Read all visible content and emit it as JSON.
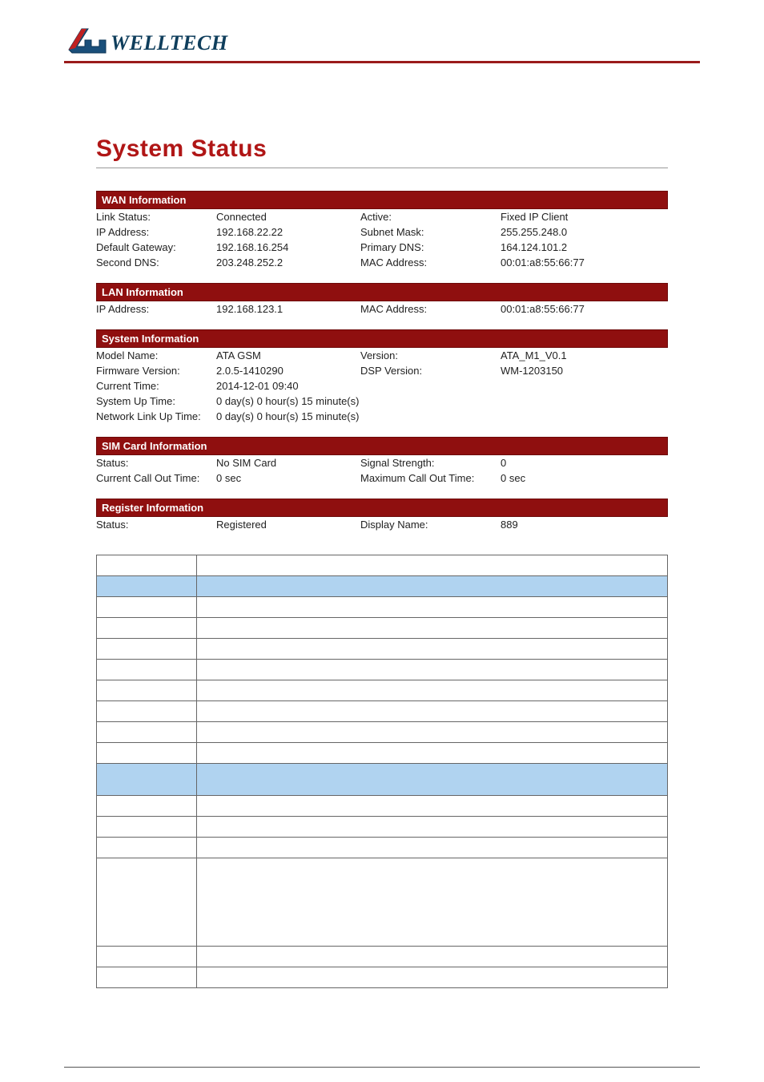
{
  "logo_text": "WELLTECH",
  "page_title": "System Status",
  "sections": {
    "wan": {
      "header": "WAN Information",
      "rows": [
        {
          "l1": "Link Status:",
          "v1": "Connected",
          "l2": "Active:",
          "v2": "Fixed IP Client"
        },
        {
          "l1": "IP Address:",
          "v1": "192.168.22.22",
          "l2": "Subnet Mask:",
          "v2": "255.255.248.0"
        },
        {
          "l1": "Default Gateway:",
          "v1": "192.168.16.254",
          "l2": "Primary DNS:",
          "v2": "164.124.101.2"
        },
        {
          "l1": "Second DNS:",
          "v1": "203.248.252.2",
          "l2": "MAC Address:",
          "v2": "00:01:a8:55:66:77"
        }
      ]
    },
    "lan": {
      "header": "LAN Information",
      "rows": [
        {
          "l1": "IP Address:",
          "v1": "192.168.123.1",
          "l2": "MAC Address:",
          "v2": "00:01:a8:55:66:77"
        }
      ]
    },
    "sys": {
      "header": "System Information",
      "rows": [
        {
          "l1": "Model Name:",
          "v1": "ATA GSM",
          "l2": "Version:",
          "v2": "ATA_M1_V0.1"
        },
        {
          "l1": "Firmware Version:",
          "v1": "2.0.5-1410290",
          "l2": "DSP Version:",
          "v2": "WM-1203150"
        },
        {
          "l1": "Current Time:",
          "v1": "2014-12-01 09:40",
          "l2": "",
          "v2": ""
        },
        {
          "l1": "System Up Time:",
          "v1": "0 day(s) 0 hour(s) 15 minute(s)",
          "l2": "",
          "v2": ""
        },
        {
          "l1": "Network Link Up Time:",
          "v1": "0 day(s) 0 hour(s) 15 minute(s)",
          "l2": "",
          "v2": ""
        }
      ]
    },
    "sim": {
      "header": "SIM Card Information",
      "rows": [
        {
          "l1": "Status:",
          "v1": "No SIM Card",
          "l2": "Signal Strength:",
          "v2": "0"
        },
        {
          "l1": "Current Call Out Time:",
          "v1": "0 sec",
          "l2": "Maximum Call Out Time:",
          "v2": "0 sec"
        }
      ]
    },
    "reg": {
      "header": "Register Information",
      "rows": [
        {
          "l1": "Status:",
          "v1": "Registered",
          "l2": "Display Name:",
          "v2": "889"
        }
      ]
    }
  },
  "lower_table_rows": [
    {
      "type": "white",
      "c1": "",
      "c2": ""
    },
    {
      "type": "blue",
      "c1": "",
      "c2": ""
    },
    {
      "type": "white",
      "c1": "",
      "c2": ""
    },
    {
      "type": "white",
      "c1": "",
      "c2": ""
    },
    {
      "type": "white",
      "c1": "",
      "c2": ""
    },
    {
      "type": "white",
      "c1": "",
      "c2": ""
    },
    {
      "type": "white",
      "c1": "",
      "c2": ""
    },
    {
      "type": "white",
      "c1": "",
      "c2": ""
    },
    {
      "type": "white",
      "c1": "",
      "c2": ""
    },
    {
      "type": "white",
      "c1": "",
      "c2": ""
    },
    {
      "type": "blue-tall",
      "c1": "",
      "c2": ""
    },
    {
      "type": "white",
      "c1": "",
      "c2": ""
    },
    {
      "type": "white",
      "c1": "",
      "c2": ""
    },
    {
      "type": "white",
      "c1": "",
      "c2": ""
    },
    {
      "type": "white-tall",
      "c1": "",
      "c2": ""
    },
    {
      "type": "white",
      "c1": "",
      "c2": ""
    },
    {
      "type": "white",
      "c1": "",
      "c2": ""
    }
  ]
}
